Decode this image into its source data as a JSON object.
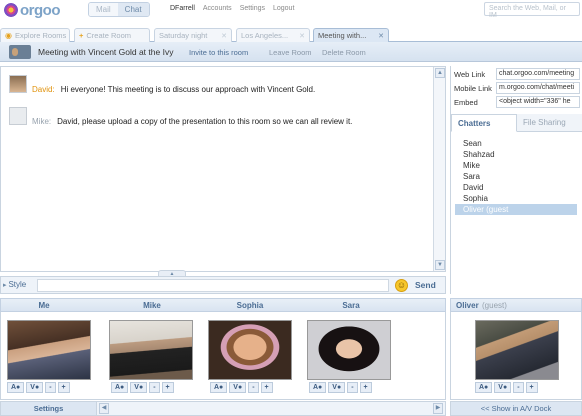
{
  "logo": {
    "text": "orgoo"
  },
  "app_tabs": [
    "Mail",
    "Chat"
  ],
  "user_links": {
    "username": "DFarrell",
    "accounts": "Accounts",
    "settings": "Settings",
    "logout": "Logout"
  },
  "search": {
    "placeholder": "Search the Web, Mail, or IM"
  },
  "room_tabs": [
    {
      "label": "Explore Rooms"
    },
    {
      "label": "Create Room"
    },
    {
      "label": "Saturday night"
    },
    {
      "label": "Los Angeles..."
    },
    {
      "label": "Meeting with..."
    }
  ],
  "meeting_bar": {
    "title": "Meeting with Vincent Gold at the Ivy",
    "invite": "Invite to this room",
    "leave": "Leave Room",
    "delete": "Delete Room"
  },
  "messages": [
    {
      "speaker": "David:",
      "text": "Hi everyone! This meeting is to discuss our approach with Vincent Gold."
    },
    {
      "speaker": "Mike:",
      "text": "David, please upload a copy of the presentation to this room so we can all review it."
    }
  ],
  "input_row": {
    "style": "Style",
    "send": "Send"
  },
  "links": [
    {
      "label": "Web Link",
      "value": "chat.orgoo.com/meeting"
    },
    {
      "label": "Mobile Link",
      "value": "m.orgoo.com/chat/meeti"
    },
    {
      "label": "Embed",
      "value": "<object width=\"336\" he"
    }
  ],
  "side_tabs": {
    "chatters": "Chatters",
    "file_sharing": "File Sharing"
  },
  "chatters": [
    "Sean",
    "Shahzad",
    "Mike",
    "Sara",
    "David",
    "Sophia",
    "Oliver (guest"
  ],
  "video": {
    "participants": [
      "Me",
      "Mike",
      "Sophia",
      "Sara"
    ],
    "controls": [
      "A●",
      "V●",
      "-",
      "+"
    ],
    "settings": "Settings",
    "guest_name": "Oliver",
    "guest_suffix": "(guest)",
    "show_dock": "<< Show in A/V Dock"
  }
}
